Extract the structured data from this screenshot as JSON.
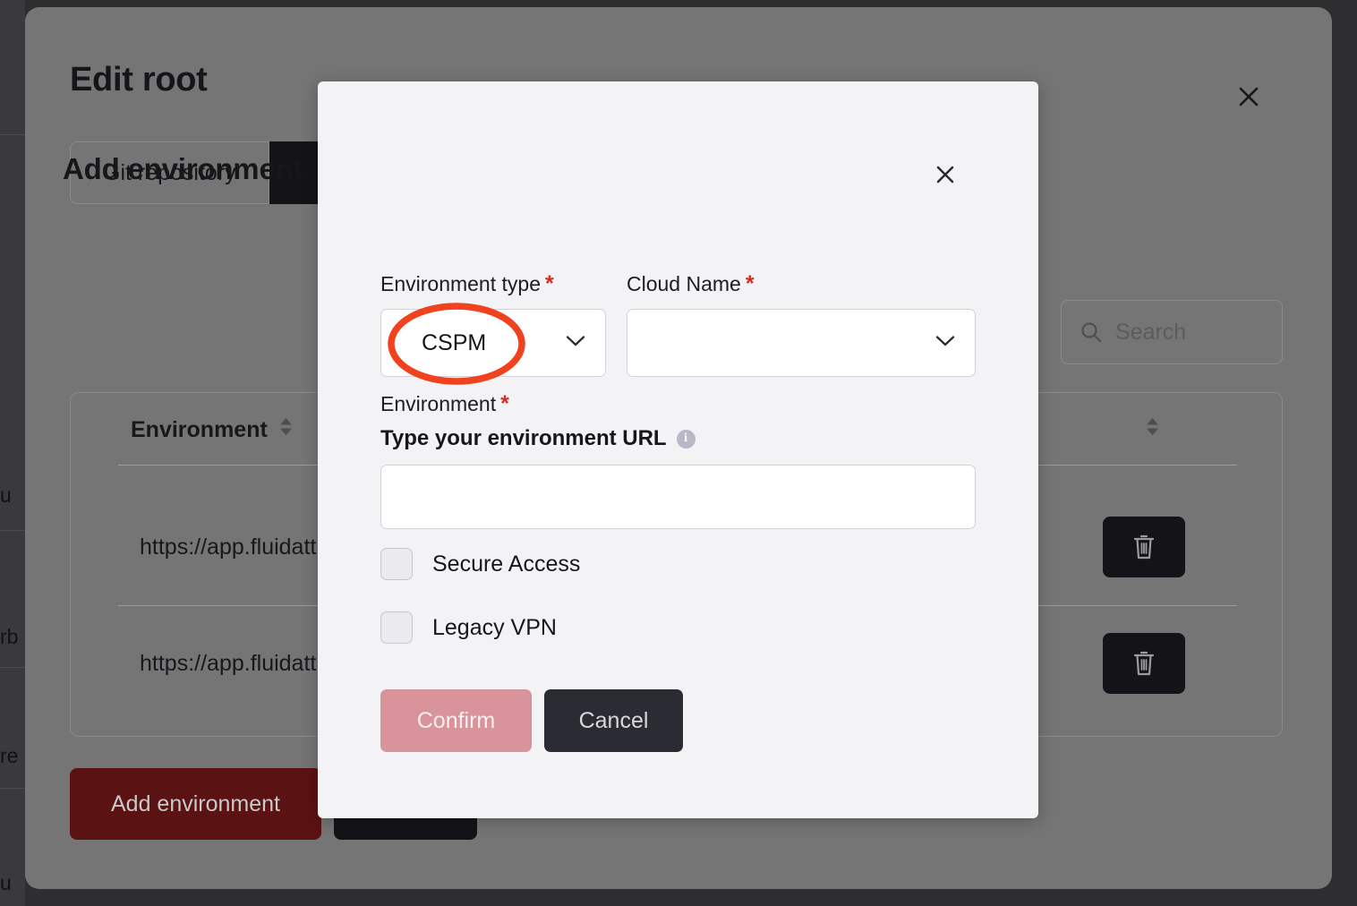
{
  "background_page": {
    "title": "Edit root",
    "close_icon": "close-icon",
    "tabs": [
      {
        "label": "Git repository",
        "active": false
      },
      {
        "label": "",
        "active": true
      }
    ],
    "search": {
      "placeholder": "Search",
      "icon": "search-icon",
      "value": ""
    },
    "table": {
      "columns": [
        {
          "label": "Environment",
          "sortable": true
        },
        {
          "label": "",
          "sortable": true
        }
      ],
      "rows": [
        {
          "environment": "https://app.fluidatt",
          "action_icon": "trash-icon"
        },
        {
          "environment": "https://app.fluidatt",
          "action_icon": "trash-icon"
        }
      ]
    },
    "add_environment_label": "Add environment",
    "edge_fragments": [
      "u",
      "rb",
      "re",
      "u"
    ]
  },
  "modal": {
    "title": "Add environment",
    "close_icon": "close-icon",
    "fields": {
      "environment_type": {
        "label": "Environment type",
        "required_marker": "*",
        "value": "CSPM",
        "chevron_icon": "chevron-down-icon"
      },
      "cloud_name": {
        "label": "Cloud Name",
        "required_marker": "*",
        "value": "",
        "chevron_icon": "chevron-down-icon"
      },
      "environment": {
        "label": "Environment",
        "required_marker": "*",
        "url_label": "Type your environment URL",
        "info_icon": "info-icon",
        "url_value": "",
        "url_placeholder": ""
      }
    },
    "checkboxes": [
      {
        "label": "Secure Access",
        "checked": false
      },
      {
        "label": "Legacy VPN",
        "checked": false
      }
    ],
    "buttons": {
      "confirm": "Confirm",
      "cancel": "Cancel"
    }
  },
  "annotation": {
    "type": "ellipse-highlight",
    "target": "CSPM",
    "color": "#f0421f"
  },
  "colors": {
    "page_backdrop": "#2e2e31",
    "dim_overlay": "#757575",
    "modal_bg": "#f3f3f6",
    "dark_button": "#141418",
    "danger_button": "#5b1212",
    "confirm_button": "#d9939a",
    "required_asterisk": "#d32d21",
    "annotation": "#f0421f"
  }
}
